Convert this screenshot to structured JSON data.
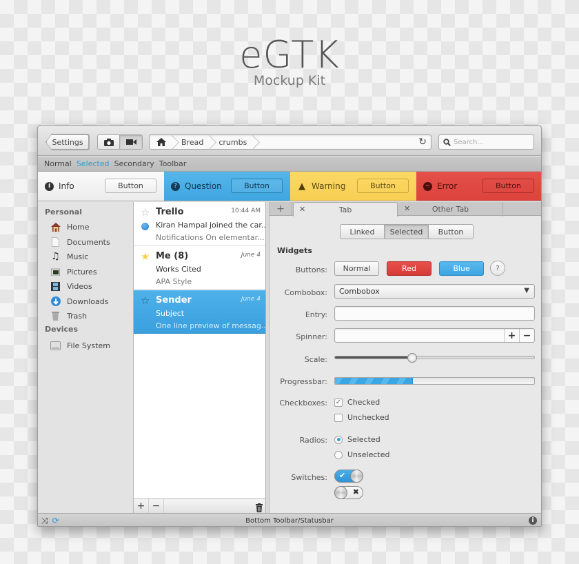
{
  "hero": {
    "title": "eGTK",
    "subtitle": "Mockup Kit"
  },
  "headerbar": {
    "settings_label": "Settings",
    "media_buttons": [
      {
        "icon": "camera-icon",
        "active": false
      },
      {
        "icon": "video-icon",
        "active": true
      }
    ],
    "breadcrumbs": [
      "Bread",
      "crumbs"
    ],
    "home_icon": "home-icon",
    "refresh_icon": "refresh-icon",
    "search_placeholder": "Search..."
  },
  "secondary_toolbar": {
    "items": [
      {
        "label": "Normal",
        "selected": false
      },
      {
        "label": "Selected",
        "selected": true
      },
      {
        "label": "Secondary",
        "selected": false
      },
      {
        "label": "Toolbar",
        "selected": false
      }
    ]
  },
  "infobars": [
    {
      "type": "info",
      "label": "Info",
      "button": "Button",
      "color": "#f5f5f5"
    },
    {
      "type": "question",
      "label": "Question",
      "button": "Button",
      "color": "#4aaee6"
    },
    {
      "type": "warning",
      "label": "Warning",
      "button": "Button",
      "color": "#f9d35c"
    },
    {
      "type": "error",
      "label": "Error",
      "button": "Button",
      "color": "#e04a44"
    }
  ],
  "sidebar": {
    "sections": [
      {
        "title": "Personal",
        "items": [
          {
            "label": "Home",
            "icon": "home-icon"
          },
          {
            "label": "Documents",
            "icon": "document-icon"
          },
          {
            "label": "Music",
            "icon": "music-icon"
          },
          {
            "label": "Pictures",
            "icon": "pictures-icon"
          },
          {
            "label": "Videos",
            "icon": "videos-icon"
          },
          {
            "label": "Downloads",
            "icon": "downloads-icon"
          },
          {
            "label": "Trash",
            "icon": "trash-icon"
          }
        ]
      },
      {
        "title": "Devices",
        "items": [
          {
            "label": "File System",
            "icon": "drive-icon"
          }
        ]
      }
    ]
  },
  "messages": [
    {
      "from": "Trello",
      "date": "10:44 AM",
      "line2": "Kiran Hampal joined the car...",
      "line3": "Notifications On elementar...",
      "starred": false,
      "unread": true,
      "selected": false
    },
    {
      "from": "Me (8)",
      "date": "June 4",
      "line2": "Works Cited",
      "line3": "APA Style",
      "starred": true,
      "unread": false,
      "selected": false
    },
    {
      "from": "Sender",
      "date": "June 4",
      "line2": "Subject",
      "line3": "One line preview of messag...",
      "starred": false,
      "unread": false,
      "selected": true
    }
  ],
  "list_toolbar": {
    "add": "+",
    "remove": "−"
  },
  "tabs": [
    {
      "label": "Tab",
      "active": true
    },
    {
      "label": "Other Tab",
      "active": false
    }
  ],
  "linked_buttons": [
    {
      "label": "Linked",
      "active": false
    },
    {
      "label": "Selected",
      "active": true
    },
    {
      "label": "Button",
      "active": false
    }
  ],
  "widgets": {
    "heading": "Widgets",
    "buttons_label": "Buttons:",
    "button_normal": "Normal",
    "button_red": "Red",
    "button_blue": "Blue",
    "help_glyph": "?",
    "combobox_label": "Combobox:",
    "combobox_value": "Combobox",
    "entry_label": "Entry:",
    "entry_value": "",
    "spinner_label": "Spinner:",
    "spinner_value": "",
    "spinner_plus": "+",
    "spinner_minus": "−",
    "scale_label": "Scale:",
    "scale_value": 0.39,
    "progress_label": "Progressbar:",
    "progress_value": 0.39,
    "checkboxes_label": "Checkboxes:",
    "checkboxes": [
      {
        "label": "Checked",
        "checked": true
      },
      {
        "label": "Unchecked",
        "checked": false
      }
    ],
    "radios_label": "Radios:",
    "radios": [
      {
        "label": "Selected",
        "selected": true
      },
      {
        "label": "Unselected",
        "selected": false
      }
    ],
    "switches_label": "Switches:",
    "switches": [
      {
        "on": true
      },
      {
        "on": false
      }
    ]
  },
  "statusbar": {
    "text": "Bottom Toolbar/Statusbar"
  },
  "colors": {
    "accent": "#3ea6e2",
    "red": "#dc433d",
    "warning": "#f9d35c"
  }
}
